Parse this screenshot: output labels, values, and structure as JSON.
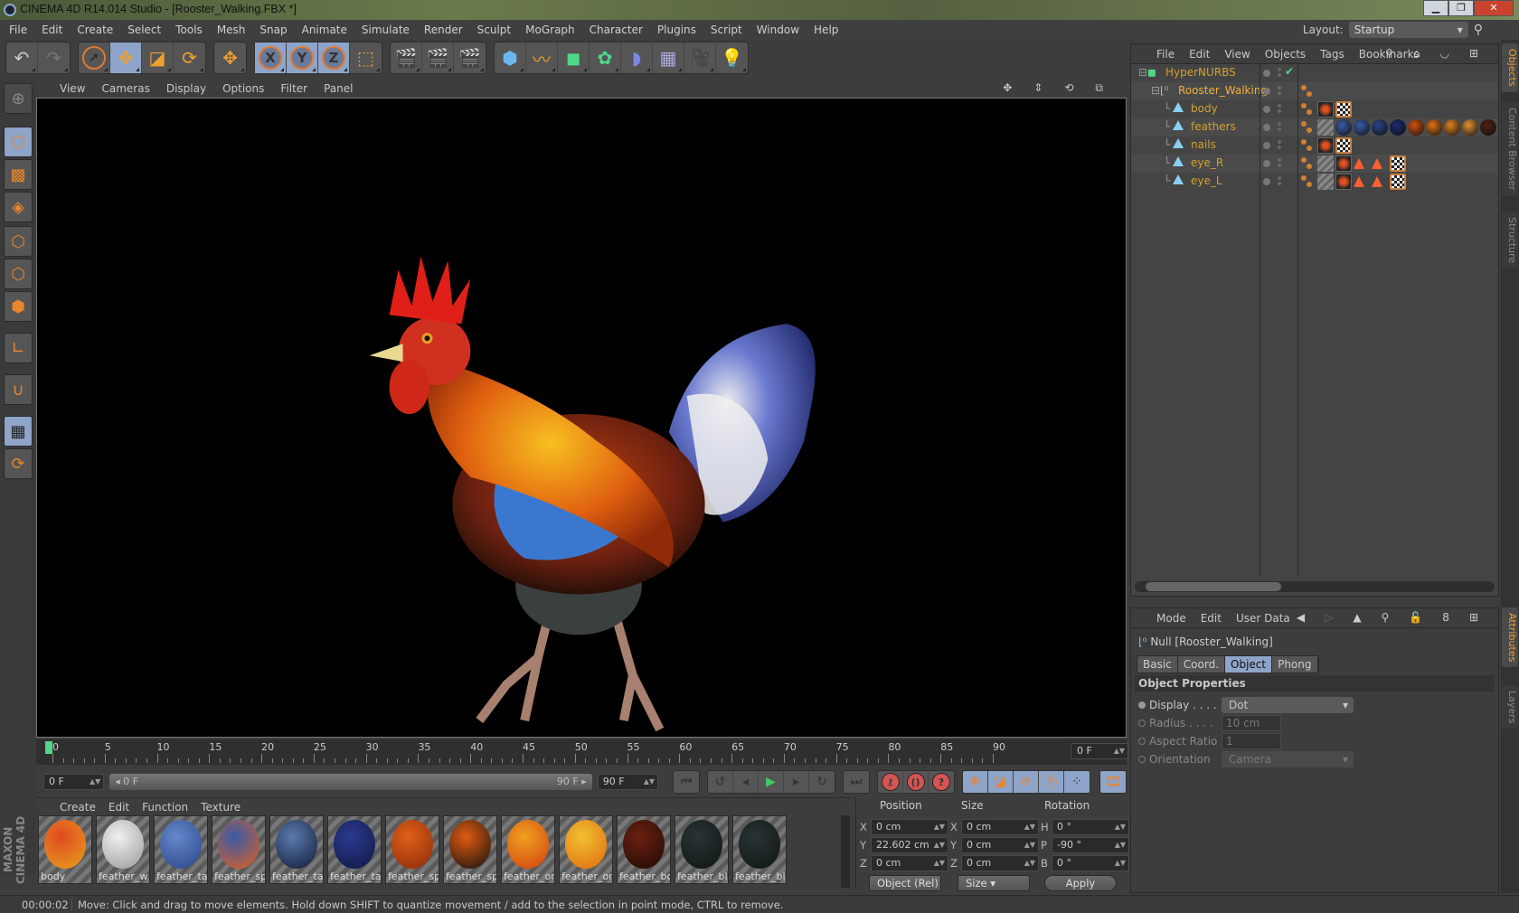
{
  "window": {
    "title": "CINEMA 4D R14.014 Studio - [Rooster_Walking.FBX *]",
    "controls": [
      "minimize",
      "restore",
      "close"
    ]
  },
  "menubar": [
    "File",
    "Edit",
    "Create",
    "Select",
    "Tools",
    "Mesh",
    "Snap",
    "Animate",
    "Simulate",
    "Render",
    "Sculpt",
    "MoGraph",
    "Character",
    "Plugins",
    "Script",
    "Window",
    "Help"
  ],
  "layout": {
    "label": "Layout:",
    "value": "Startup"
  },
  "toolbar": {
    "groups": [
      [
        "undo-icon",
        "redo-icon"
      ],
      [
        "live-selection-icon",
        "move-icon",
        "scale-icon",
        "rotate-icon"
      ],
      [
        "recent-tool-icon"
      ],
      [
        "x-axis-lock-icon",
        "y-axis-lock-icon",
        "z-axis-lock-icon",
        "coordinate-system-icon"
      ],
      [
        "render-view-icon",
        "render-picture-viewer-icon",
        "render-settings-icon"
      ],
      [
        "cube-icon",
        "spline-pen-icon",
        "hypernurbs-icon",
        "array-icon",
        "deformer-bend-icon",
        "floor-icon",
        "camera-icon",
        "light-icon"
      ]
    ]
  },
  "left_tools": [
    "make-editable-icon",
    "model-mode-icon",
    "texture-mode-icon",
    "workplane-mode-icon",
    "point-mode-icon",
    "edge-mode-icon",
    "polygon-mode-icon",
    "axis-mode-icon",
    "magnet-snap-icon",
    "lock-workplane-icon",
    "workplane-align-icon"
  ],
  "viewport": {
    "menu": [
      "View",
      "Cameras",
      "Display",
      "Options",
      "Filter",
      "Panel"
    ],
    "icons": [
      "pan-icon",
      "dolly-icon",
      "orbit-icon",
      "maximize-icon"
    ],
    "content": "3D rooster model render"
  },
  "timeline": {
    "ticks": [
      "0",
      "5",
      "10",
      "15",
      "20",
      "25",
      "30",
      "35",
      "40",
      "45",
      "50",
      "55",
      "60",
      "65",
      "70",
      "75",
      "80",
      "85",
      "90"
    ],
    "current_frame": "0 F",
    "start": "0 F",
    "range_start": "0 F",
    "range_end": "90 F",
    "end": "90 F"
  },
  "playback": {
    "buttons": [
      "go-to-start-icon",
      "previous-key-icon",
      "previous-frame-icon",
      "play-icon",
      "next-frame-icon",
      "next-key-icon",
      "go-to-end-icon"
    ],
    "record": [
      "record-key-icon",
      "autokey-icon",
      "keyframe-selection-icon"
    ],
    "key_types": [
      "position-key-icon",
      "scale-key-icon",
      "rotation-key-icon",
      "parameter-key-icon",
      "point-level-key-icon"
    ],
    "timeline-icon": "film-icon"
  },
  "material_manager": {
    "menu": [
      "Create",
      "Edit",
      "Function",
      "Texture"
    ],
    "materials": [
      {
        "name": "body",
        "colors": [
          "#e04a20",
          "#1a1a1a",
          "#e8a020"
        ]
      },
      {
        "name": "feather_w",
        "colors": [
          "#f0f0f0",
          "#999"
        ]
      },
      {
        "name": "feather_tai",
        "colors": [
          "#6688cc",
          "#2a4488"
        ]
      },
      {
        "name": "feather_spi",
        "colors": [
          "#3a5aa8",
          "#e06020"
        ]
      },
      {
        "name": "feather_tai",
        "colors": [
          "#5a7ab0",
          "#111a33"
        ]
      },
      {
        "name": "feather_tai",
        "colors": [
          "#2a3a90",
          "#101840"
        ]
      },
      {
        "name": "feather_spi",
        "colors": [
          "#e06018",
          "#8a2a08"
        ]
      },
      {
        "name": "feather_spi",
        "colors": [
          "#e05a10",
          "#111"
        ]
      },
      {
        "name": "feather_ora",
        "colors": [
          "#f0a020",
          "#d04010"
        ]
      },
      {
        "name": "feather_ora",
        "colors": [
          "#f0c030",
          "#e06a10"
        ]
      },
      {
        "name": "feather_bo",
        "colors": [
          "#6a2010",
          "#200a05"
        ]
      },
      {
        "name": "feather_bla",
        "colors": [
          "#2a3434",
          "#0e1414"
        ]
      },
      {
        "name": "feather_bla",
        "colors": [
          "#2a3434",
          "#0e1414"
        ]
      }
    ],
    "brand": "MAXON CINEMA 4D"
  },
  "coordinates": {
    "headers": [
      "Position",
      "Size",
      "Rotation"
    ],
    "rows": [
      {
        "pos_axis": "X",
        "pos": "0 cm",
        "size_axis": "X",
        "size": "0 cm",
        "rot_axis": "H",
        "rot": "0 °"
      },
      {
        "pos_axis": "Y",
        "pos": "22.602 cm",
        "size_axis": "Y",
        "size": "0 cm",
        "rot_axis": "P",
        "rot": "-90 °"
      },
      {
        "pos_axis": "Z",
        "pos": "0 cm",
        "size_axis": "Z",
        "size": "0 cm",
        "rot_axis": "B",
        "rot": "0 °"
      }
    ],
    "mode": "Object (Rel)",
    "size_mode": "Size",
    "apply": "Apply"
  },
  "status": {
    "time": "00:00:02",
    "message": "Move: Click and drag to move elements. Hold down SHIFT to quantize movement / add to the selection in point mode, CTRL to remove."
  },
  "object_manager": {
    "menu": [
      "File",
      "Edit",
      "View",
      "Objects",
      "Tags",
      "Bookmarks"
    ],
    "objects": [
      {
        "name": "HyperNURBS",
        "level": 0,
        "type": "hypernurbs",
        "check": "✔"
      },
      {
        "name": "Rooster_Walking",
        "level": 1,
        "type": "null"
      },
      {
        "name": "body",
        "level": 2,
        "type": "polygon",
        "tags": [
          "mat1",
          "chk"
        ]
      },
      {
        "name": "feathers",
        "level": 2,
        "type": "polygon",
        "tags": [
          "tex",
          "ball:#3a5aa8",
          "ball:#3a5aa8",
          "ball:#2a4488",
          "ball:#1a2a70",
          "ball:#d05010",
          "ball:#e07010",
          "ball:#e08020",
          "ball:#e09030",
          "ball:#502010"
        ]
      },
      {
        "name": "nails",
        "level": 2,
        "type": "polygon",
        "tags": [
          "mat1",
          "chk"
        ]
      },
      {
        "name": "eye_R",
        "level": 2,
        "type": "polygon",
        "tags": [
          "tex",
          "mat1",
          "tri",
          "tri",
          "chk"
        ]
      },
      {
        "name": "eye_L",
        "level": 2,
        "type": "polygon",
        "tags": [
          "tex",
          "mat1",
          "tri",
          "tri",
          "chk"
        ]
      }
    ]
  },
  "attribute_manager": {
    "menu": [
      "Mode",
      "Edit",
      "User Data"
    ],
    "title": "Null [Rooster_Walking]",
    "tabs": [
      {
        "label": "Basic",
        "active": false
      },
      {
        "label": "Coord.",
        "active": false
      },
      {
        "label": "Object",
        "active": true
      },
      {
        "label": "Phong",
        "active": false
      }
    ],
    "section": "Object Properties",
    "properties": [
      {
        "label": "Display . . . .",
        "value": "Dot",
        "type": "dropdown",
        "enabled": true
      },
      {
        "label": "Radius . . . .",
        "value": "10 cm",
        "type": "number",
        "enabled": false
      },
      {
        "label": "Aspect Ratio",
        "value": "1",
        "type": "number",
        "enabled": false
      },
      {
        "label": "Orientation",
        "value": "Camera",
        "type": "dropdown",
        "enabled": false
      }
    ]
  },
  "side_tabs_top": [
    {
      "label": "Objects",
      "active": true
    },
    {
      "label": "Content Browser",
      "active": false
    },
    {
      "label": "Structure",
      "active": false
    }
  ],
  "side_tabs_bottom": [
    {
      "label": "Attributes",
      "active": true
    },
    {
      "label": "Layers",
      "active": false
    }
  ],
  "colors": {
    "accent": "#f0a030",
    "selection": "#8ea4c8",
    "play": "#3ec866",
    "record": "#d45555",
    "object_name": "#d4a030"
  }
}
